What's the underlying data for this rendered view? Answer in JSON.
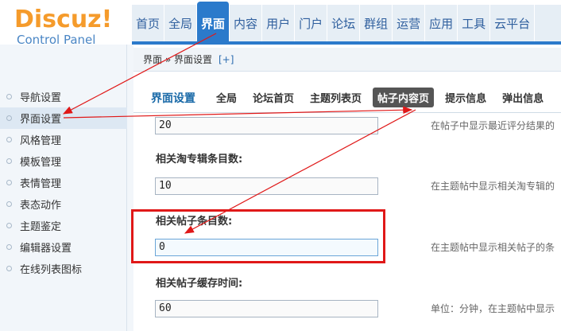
{
  "app": {
    "logo_text": "Discuz!",
    "logo_subtitle": "Control Panel"
  },
  "topnav": {
    "items": [
      "首页",
      "全局",
      "界面",
      "内容",
      "用户",
      "门户",
      "论坛",
      "群组",
      "运营",
      "应用",
      "工具",
      "云平台"
    ],
    "active": "界面"
  },
  "breadcrumb": {
    "text": "界面 » 界面设置",
    "add": "[+]"
  },
  "sidebar": {
    "items": [
      "导航设置",
      "界面设置",
      "风格管理",
      "模板管理",
      "表情管理",
      "表态动作",
      "主题鉴定",
      "编辑器设置",
      "在线列表图标"
    ],
    "active": "界面设置"
  },
  "tabs": {
    "heading": "界面设置",
    "items": [
      "全局",
      "论坛首页",
      "主题列表页",
      "帖子内容页",
      "提示信息",
      "弹出信息"
    ],
    "active": "帖子内容页"
  },
  "settings": [
    {
      "label": "",
      "value": "20",
      "desc": "在帖子中显示最近评分结果的"
    },
    {
      "label": "相关淘专辑条目数:",
      "value": "10",
      "desc": "在主题帖中显示相关淘专辑的"
    },
    {
      "label": "相关帖子条目数:",
      "value": "0",
      "desc": "在主题帖中显示相关帖子的条"
    },
    {
      "label": "相关帖子缓存时间:",
      "value": "60",
      "desc": "单位：分钟，在主题帖中显示"
    }
  ],
  "colors": {
    "accent": "#2b7acb",
    "logo_orange": "#f59b2b",
    "annotation_red": "#e01818"
  }
}
